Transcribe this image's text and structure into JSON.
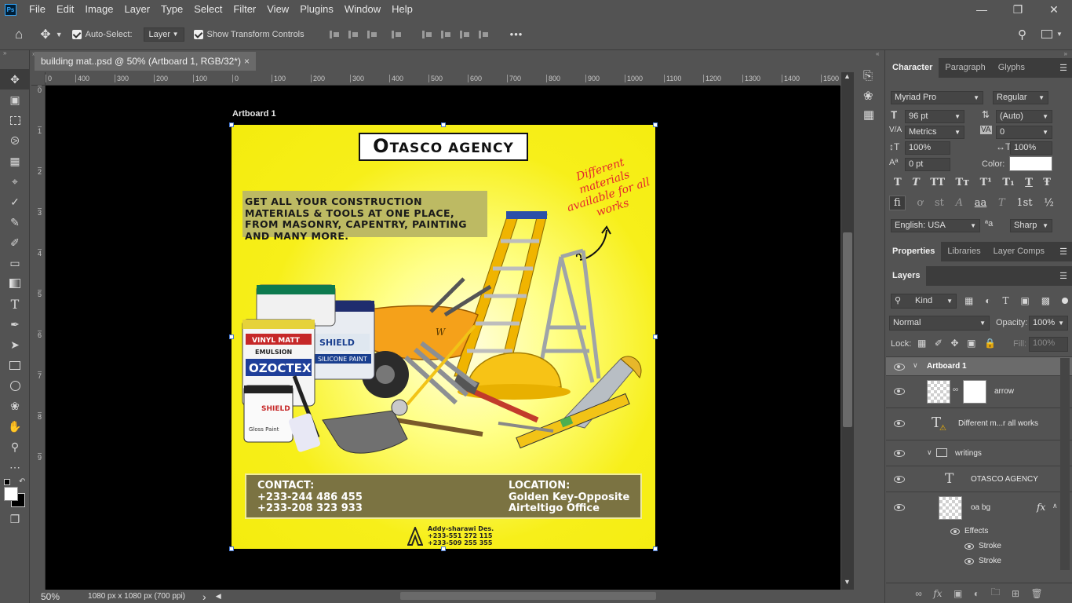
{
  "app": {
    "logo": "Ps"
  },
  "menu": [
    "File",
    "Edit",
    "Image",
    "Layer",
    "Type",
    "Select",
    "Filter",
    "View",
    "Plugins",
    "Window",
    "Help"
  ],
  "options": {
    "auto_select_label": "Auto-Select:",
    "auto_select_target": "Layer",
    "show_transform_label": "Show Transform Controls",
    "more": "•••"
  },
  "document": {
    "tab_title": "building mat..psd @ 50% (Artboard 1, RGB/32*)",
    "close": "×",
    "artboard_label": "Artboard 1"
  },
  "ruler": {
    "h": [
      "0",
      "400",
      "300",
      "200",
      "100",
      "0",
      "100",
      "200",
      "300",
      "400",
      "500",
      "600",
      "700",
      "800",
      "900",
      "1000",
      "1100",
      "1200",
      "1300",
      "1400",
      "1500"
    ],
    "v": [
      "0",
      "1",
      "2",
      "3",
      "4",
      "5",
      "6",
      "7",
      "8",
      "9"
    ]
  },
  "status": {
    "zoom": "50%",
    "doc_size": "1080 px x 1080 px (700 ppi)",
    "arrow": "›"
  },
  "flyer": {
    "title_first": "O",
    "title_rest": "TASCO AGENCY",
    "tagline": "GET ALL YOUR CONSTRUCTION MATERIALS & TOOLS AT ONE PLACE, FROM MASONRY, CAPENTRY, PAINTING AND MANY MORE.",
    "script_text": "Different materials available for all works",
    "contact_title": "CONTACT:",
    "contact_1": "+233-244 486 455",
    "contact_2": "+233-208 323 933",
    "location_title": "LOCATION:",
    "location_1": "Golden Key-Opposite",
    "location_2": "Airteltigo Office",
    "credit_name": "Addy-sharawi Des.",
    "credit_1": "+233-551 272 115",
    "credit_2": "+233-509 255 355",
    "paint1_label": "VINYL MATT",
    "paint1_sub": "EMULSION",
    "paint1_brand": "OZOCTEX",
    "paint2_brand": "SHIELD",
    "paint2_sub": "SILICONE PAINT",
    "paint3_label": "Gloss Paint",
    "paint3_brand": "SHIELD",
    "barrow_brand": "W"
  },
  "character": {
    "tabs": [
      "Character",
      "Paragraph",
      "Glyphs"
    ],
    "font": "Myriad Pro",
    "style": "Regular",
    "size": "96 pt",
    "leading": "(Auto)",
    "kerning": "Metrics",
    "tracking": "0",
    "vscale": "100%",
    "hscale": "100%",
    "baseline": "0 pt",
    "color_label": "Color:",
    "type_buttons": [
      "T",
      "T",
      "TT",
      "Tт",
      "T¹",
      "T₁",
      "T",
      "Ŧ"
    ],
    "ot_buttons": [
      "fi",
      "ơ",
      "st",
      "A",
      "aa",
      "T",
      "1st",
      "½"
    ],
    "language": "English: USA",
    "aa_icon": "ªa",
    "aa_mode": "Sharp"
  },
  "properties": {
    "tabs": [
      "Properties",
      "Libraries",
      "Layer Comps"
    ]
  },
  "layers": {
    "tab": "Layers",
    "kind": "Kind",
    "blend": "Normal",
    "opacity_label": "Opacity:",
    "opacity": "100%",
    "lock_label": "Lock:",
    "fill_label": "Fill:",
    "fill": "100%",
    "items": [
      {
        "name": "Artboard 1"
      },
      {
        "name": "arrow"
      },
      {
        "name": "Different m...r all works"
      },
      {
        "name": "writings"
      },
      {
        "name": "OTASCO AGENCY"
      },
      {
        "name": "oa bg"
      },
      {
        "name": "Effects"
      },
      {
        "name": "Stroke"
      },
      {
        "name": "Stroke"
      }
    ],
    "fx": "fx"
  }
}
